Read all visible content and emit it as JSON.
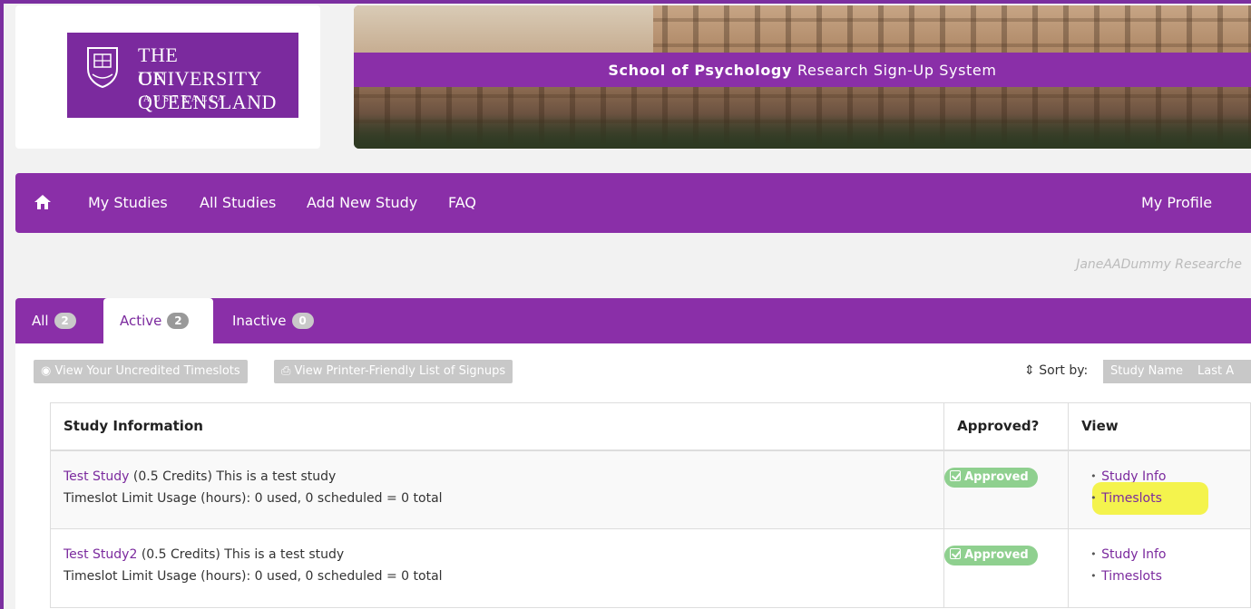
{
  "logo": {
    "line1": "THE UNIVERSITY",
    "line2": "OF QUEENSLAND",
    "line3": "AUSTRALIA"
  },
  "banner": {
    "bold": "School of Psychology",
    "rest": "Research Sign-Up System"
  },
  "nav": {
    "items": [
      "My Studies",
      "All Studies",
      "Add New Study",
      "FAQ"
    ],
    "profile": "My Profile"
  },
  "user_line": "JaneAADummy Researche",
  "tabs": [
    {
      "label": "All",
      "count": "2"
    },
    {
      "label": "Active",
      "count": "2"
    },
    {
      "label": "Inactive",
      "count": "0"
    }
  ],
  "toolbar": {
    "uncredited": "View Your Uncredited Timeslots",
    "printer": "View Printer-Friendly List of Signups",
    "sort_label": "Sort by:",
    "sort_options": [
      "Study Name",
      "Last A"
    ]
  },
  "table": {
    "headers": [
      "Study Information",
      "Approved?",
      "View"
    ],
    "rows": [
      {
        "name": "Test Study",
        "desc": "(0.5 Credits) This is a test study",
        "usage": "Timeslot Limit Usage (hours): 0 used, 0 scheduled = 0 total",
        "status": "Approved",
        "links": [
          "Study Info",
          "Timeslots"
        ]
      },
      {
        "name": "Test Study2",
        "desc": "(0.5 Credits) This is a test study",
        "usage": "Timeslot Limit Usage (hours): 0 used, 0 scheduled = 0 total",
        "status": "Approved",
        "links": [
          "Study Info",
          "Timeslots"
        ]
      }
    ]
  },
  "colors": {
    "brand_purple": "#8a2fa8",
    "approved_green": "#8fd08f",
    "highlight_yellow": "#f3f23a"
  },
  "icons": [
    "home-icon",
    "eye-icon",
    "printer-icon",
    "sort-icon",
    "check-square-icon",
    "crest-icon"
  ]
}
